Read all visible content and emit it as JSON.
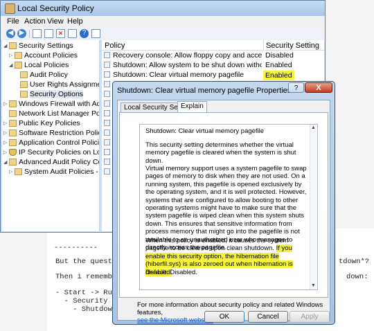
{
  "window": {
    "title": "Local Security Policy"
  },
  "menu": [
    "File",
    "Action",
    "View",
    "Help"
  ],
  "tree": [
    {
      "label": "Security Settings",
      "icon": "folder",
      "expander": "expanded"
    },
    {
      "label": "Account Policies",
      "icon": "folder",
      "expander": "collapsed"
    },
    {
      "label": "Local Policies",
      "icon": "folder",
      "expander": "expanded"
    },
    {
      "label": "Audit Policy",
      "icon": "folder",
      "expander": ""
    },
    {
      "label": "User Rights Assignment",
      "icon": "folder",
      "expander": ""
    },
    {
      "label": "Security Options",
      "icon": "folder",
      "expander": ""
    },
    {
      "label": "Windows Firewall with Adva",
      "icon": "folder",
      "expander": "collapsed"
    },
    {
      "label": "Network List Manager Polici",
      "icon": "folder",
      "expander": ""
    },
    {
      "label": "Public Key Policies",
      "icon": "folder",
      "expander": "collapsed"
    },
    {
      "label": "Software Restriction Policies",
      "icon": "folder",
      "expander": "collapsed"
    },
    {
      "label": "Application Control Policies",
      "icon": "folder",
      "expander": "collapsed"
    },
    {
      "label": "IP Security Policies on Local",
      "icon": "shield",
      "expander": "collapsed"
    },
    {
      "label": "Advanced Audit Policy Config",
      "icon": "folder",
      "expander": "expanded"
    },
    {
      "label": "System Audit Policies - Lo",
      "icon": "folder",
      "expander": "collapsed"
    }
  ],
  "list": {
    "columns": {
      "policy": "Policy",
      "setting": "Security Setting"
    },
    "rows": [
      {
        "policy": "Recovery console: Allow floppy copy and access to all ...",
        "setting": "Disabled",
        "highlight": false
      },
      {
        "policy": "Shutdown: Allow system to be shut down without havi...",
        "setting": "Enabled",
        "highlight": false
      },
      {
        "policy": "Shutdown: Clear virtual memory pagefile",
        "setting": "Enabled",
        "highlight": true
      }
    ]
  },
  "dialog": {
    "title": "Shutdown: Clear virtual memory pagefile Properties",
    "help_label": "?",
    "close_label": "X",
    "tabs": [
      "Local Security Setting",
      "Explain"
    ],
    "active_tab": "Explain",
    "explain": {
      "heading": "Shutdown: Clear virtual memory pagefile",
      "p1": "This security setting determines whether the virtual memory pagefile is cleared when the system is shut down.",
      "p2": "Virtual memory support uses a system pagefile to swap pages of memory to disk when they are not used. On a running system, this pagefile is opened exclusively by the operating system, and it is well protected. However, systems that are configured to allow booting to other operating systems might have to make sure that the system pagefile is wiped clean when this system shuts down. This ensures that sensitive information from process memory that might go into the pagefile is not available to an unauthorized user who manages to directly access the pagefile.",
      "p3_plain": "When this policy is enabled, it causes the system pagefile to be cleared upon clean shutdown.",
      "p3_highlight": "If you enable this security option, the hibernation file (hiberfil.sys) is also zeroed out when hibernation is disabled.",
      "p4": "Default: Disabled."
    },
    "footer_text": "For more information about security policy and related Windows features,",
    "footer_link": "see the Microsoft website.",
    "buttons": {
      "ok": "OK",
      "cancel": "Cancel",
      "apply": "Apply"
    }
  },
  "background_doc": {
    "lines": [
      "----------",
      "But the question",
      "Then i remembere",
      "- Start -> Run -",
      "  - Security Set",
      "    - Shutdown:"
    ],
    "fragments": [
      "tdown*?",
      "down:"
    ]
  },
  "colors": {
    "highlight": "#f7f23a",
    "title_gradient": "#a9c6e6",
    "close_button": "#c23a23"
  }
}
